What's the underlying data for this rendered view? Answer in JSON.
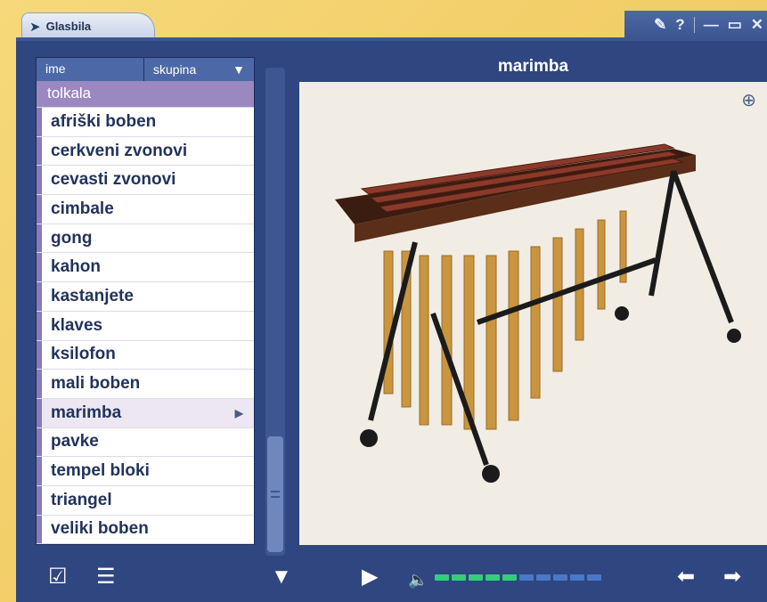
{
  "window": {
    "title": "Glasbila",
    "controls": [
      "pin-icon",
      "help-icon",
      "minimize-icon",
      "maximize-icon",
      "close-icon"
    ],
    "help_label": "?"
  },
  "list": {
    "header_name": "ime",
    "header_group": "skupina",
    "group": "tolkala",
    "items": [
      {
        "label": "afriški boben"
      },
      {
        "label": "cerkveni zvonovi"
      },
      {
        "label": "cevasti zvonovi"
      },
      {
        "label": "cimbale"
      },
      {
        "label": "gong"
      },
      {
        "label": "kahon"
      },
      {
        "label": "kastanjete"
      },
      {
        "label": "klaves"
      },
      {
        "label": "ksilofon"
      },
      {
        "label": "mali boben"
      },
      {
        "label": "marimba",
        "selected": true
      },
      {
        "label": "pavke"
      },
      {
        "label": "tempel bloki"
      },
      {
        "label": "triangel"
      },
      {
        "label": "veliki boben"
      }
    ]
  },
  "preview": {
    "title": "marimba",
    "icon": "zoom-in-icon"
  },
  "toolbar": {
    "buttons": [
      "checklist-icon",
      "list-edit-icon",
      "filter-icon",
      "play-icon",
      "speaker-icon",
      "back-arrow-icon",
      "forward-arrow-icon"
    ],
    "volume_level": 0.5,
    "volume_segments": 10
  },
  "colors": {
    "window_bg": "#2f4680",
    "accent": "#9a88c0",
    "volume_on": "#2fd07a",
    "volume_off": "#4a78c8"
  }
}
